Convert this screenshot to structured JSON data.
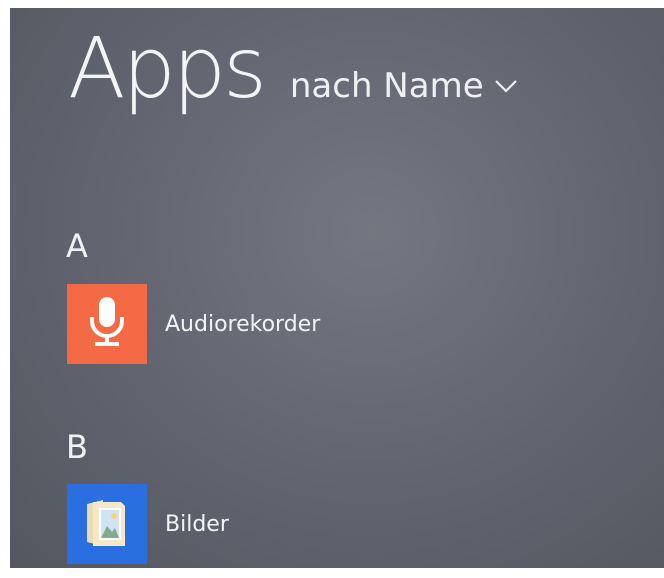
{
  "header": {
    "title": "Apps",
    "sort_label": "nach Name",
    "sort_icon": "chevron-down-icon"
  },
  "groups": [
    {
      "letter": "A",
      "apps": [
        {
          "name": "Audiorekorder",
          "icon": "microphone-icon",
          "tile_color": "#f46a45"
        }
      ]
    },
    {
      "letter": "B",
      "apps": [
        {
          "name": "Bilder",
          "icon": "pictures-icon",
          "tile_color": "#2a6fe0"
        }
      ]
    }
  ]
}
